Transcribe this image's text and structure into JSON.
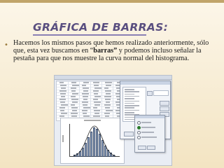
{
  "slide": {
    "title": "GRÁFICA DE BARRAS:",
    "bullet_symbol": "•",
    "paragraph_part1": "Hacemos los mismos pasos que hemos realizado anteriormente, sólo que, esta vez buscamos en “",
    "paragraph_bold": "barras”",
    "paragraph_part2": " y podemos incluso señalar la pestaña para que nos muestre  la curva normal del histograma.",
    "accent_color": "#5a4f80",
    "bullet_color": "#9a7a3c"
  },
  "screenshot": {
    "alt_semantic": "spss-histogram-dialog-screenshot"
  }
}
